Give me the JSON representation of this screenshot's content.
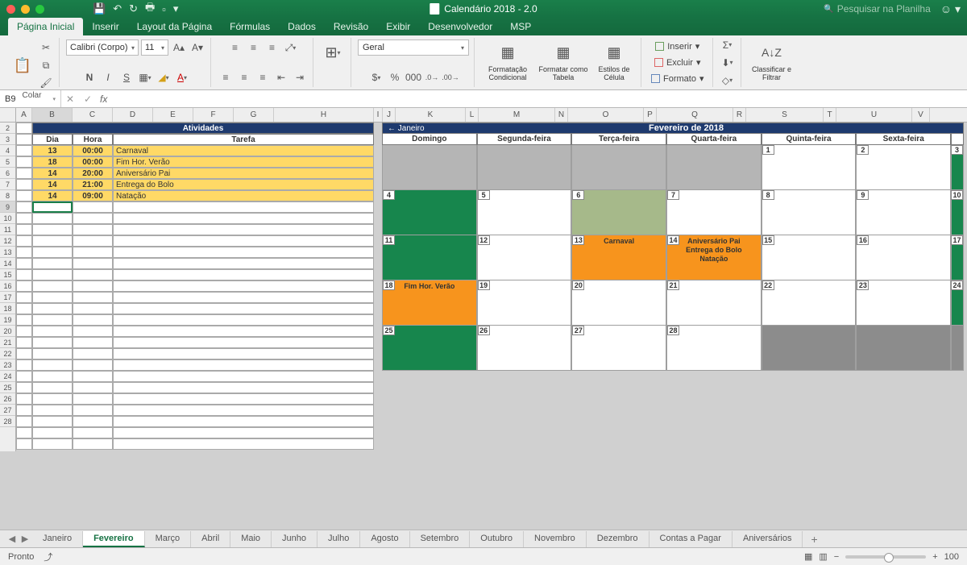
{
  "window_title": "Calendário 2018 - 2.0",
  "search_placeholder": "Pesquisar na Planilha",
  "tabs": [
    "Página Inicial",
    "Inserir",
    "Layout da Página",
    "Fórmulas",
    "Dados",
    "Revisão",
    "Exibir",
    "Desenvolvedor",
    "MSP"
  ],
  "active_tab": 0,
  "ribbon": {
    "paste_label": "Colar",
    "font_name": "Calibri (Corpo)",
    "font_size": "11",
    "bold": "N",
    "italic": "I",
    "underline": "S",
    "number_format": "Geral",
    "cond_fmt": "Formatação Condicional",
    "fmt_table": "Formatar como Tabela",
    "cell_styles": "Estilos de Célula",
    "insert": "Inserir",
    "delete": "Excluir",
    "format": "Formato",
    "sort_filter": "Classificar e Filtrar"
  },
  "namebox": "B9",
  "col_headers": [
    "A",
    "B",
    "C",
    "D",
    "E",
    "F",
    "G",
    "H",
    "I",
    "J",
    "K",
    "L",
    "M",
    "N",
    "O",
    "P",
    "Q",
    "R",
    "S",
    "T",
    "U",
    "V"
  ],
  "row_headers": [
    "2",
    "3",
    "4",
    "5",
    "6",
    "7",
    "8",
    "9",
    "10",
    "11",
    "12",
    "13",
    "14",
    "15",
    "16",
    "17",
    "18",
    "19",
    "20",
    "21",
    "22",
    "23",
    "24",
    "25",
    "26",
    "27",
    "28"
  ],
  "activities": {
    "title": "Atividades",
    "head_dia": "Dia",
    "head_hora": "Hora",
    "head_tarefa": "Tarefa",
    "rows": [
      {
        "dia": "13",
        "hora": "00:00",
        "tarefa": "Carnaval"
      },
      {
        "dia": "18",
        "hora": "00:00",
        "tarefa": "Fim Hor. Verão"
      },
      {
        "dia": "14",
        "hora": "20:00",
        "tarefa": "Aniversário Pai"
      },
      {
        "dia": "14",
        "hora": "21:00",
        "tarefa": "Entrega do Bolo"
      },
      {
        "dia": "14",
        "hora": "09:00",
        "tarefa": "Natação"
      }
    ]
  },
  "calendar": {
    "prev": "← Janeiro",
    "title": "Fevereiro de 2018",
    "days": [
      "Domingo",
      "Segunda-feira",
      "Terça-feira",
      "Quarta-feira",
      "Quinta-feira",
      "Sexta-feira"
    ],
    "weeks": [
      [
        {
          "n": "",
          "cls": "gray"
        },
        {
          "n": "",
          "cls": "gray"
        },
        {
          "n": "",
          "cls": "gray"
        },
        {
          "n": "",
          "cls": "gray"
        },
        {
          "n": "1",
          "cls": ""
        },
        {
          "n": "2",
          "cls": ""
        },
        {
          "n": "3",
          "cls": "green",
          "side": "r"
        }
      ],
      [
        {
          "n": "4",
          "cls": "green"
        },
        {
          "n": "5",
          "cls": ""
        },
        {
          "n": "6",
          "cls": "olive"
        },
        {
          "n": "7",
          "cls": ""
        },
        {
          "n": "8",
          "cls": ""
        },
        {
          "n": "9",
          "cls": ""
        },
        {
          "n": "10",
          "cls": "green",
          "side": "r"
        }
      ],
      [
        {
          "n": "11",
          "cls": "green"
        },
        {
          "n": "12",
          "cls": ""
        },
        {
          "n": "13",
          "cls": "orange",
          "ev": [
            "Carnaval"
          ]
        },
        {
          "n": "14",
          "cls": "orange",
          "ev": [
            "Aniversário Pai",
            "Entrega do Bolo",
            "Natação"
          ]
        },
        {
          "n": "15",
          "cls": ""
        },
        {
          "n": "16",
          "cls": ""
        },
        {
          "n": "17",
          "cls": "green",
          "side": "r"
        }
      ],
      [
        {
          "n": "18",
          "cls": "orange",
          "ev": [
            "Fim Hor. Verão"
          ]
        },
        {
          "n": "19",
          "cls": ""
        },
        {
          "n": "20",
          "cls": ""
        },
        {
          "n": "21",
          "cls": ""
        },
        {
          "n": "22",
          "cls": ""
        },
        {
          "n": "23",
          "cls": ""
        },
        {
          "n": "24",
          "cls": "green",
          "side": "r"
        }
      ],
      [
        {
          "n": "25",
          "cls": "green"
        },
        {
          "n": "26",
          "cls": ""
        },
        {
          "n": "27",
          "cls": ""
        },
        {
          "n": "28",
          "cls": ""
        },
        {
          "n": "",
          "cls": "dgray"
        },
        {
          "n": "",
          "cls": "dgray"
        },
        {
          "n": "",
          "cls": "dgray",
          "side": "r"
        }
      ]
    ]
  },
  "sheet_tabs": [
    "Janeiro",
    "Fevereiro",
    "Março",
    "Abril",
    "Maio",
    "Junho",
    "Julho",
    "Agosto",
    "Setembro",
    "Outubro",
    "Novembro",
    "Dezembro",
    "Contas a Pagar",
    "Aniversários"
  ],
  "active_sheet": 1,
  "status": {
    "ready": "Pronto",
    "zoom": "100"
  }
}
